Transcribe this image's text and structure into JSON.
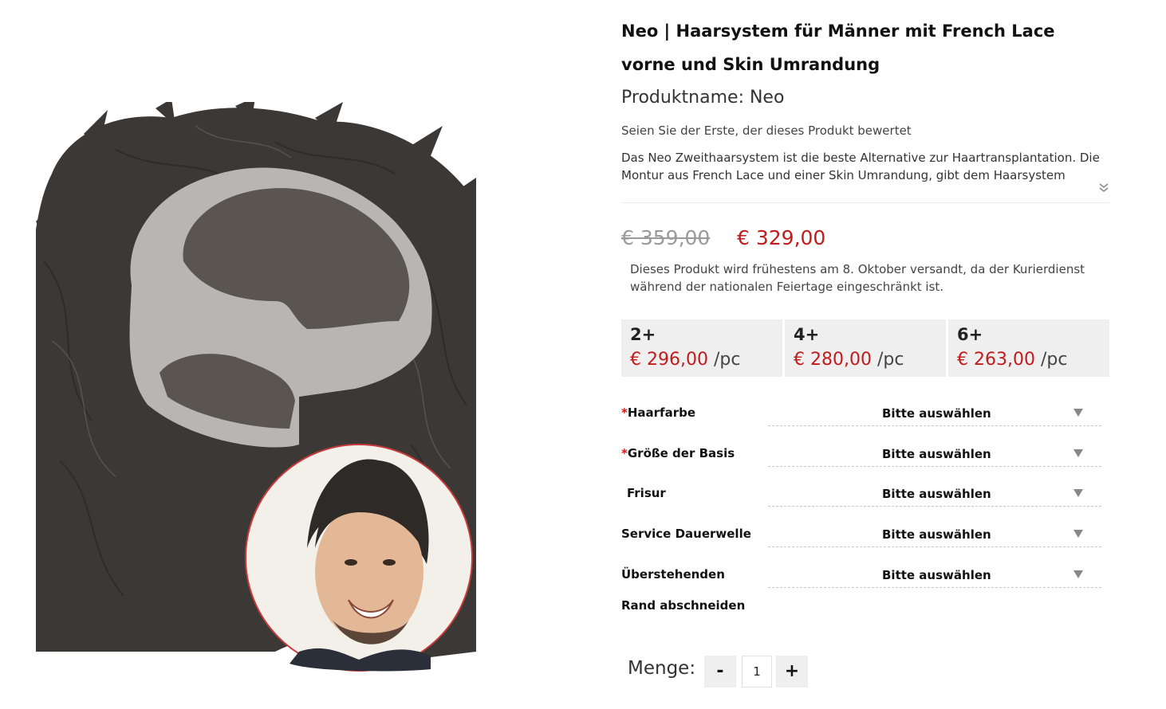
{
  "product": {
    "title": "Neo | Haarsystem für Männer mit French Lace vorne und Skin Umrandung",
    "name_line": "Produktname: Neo",
    "review_prompt": "Seien Sie der Erste, der dieses Produkt bewertet",
    "description": "Das Neo Zweithaarsystem ist die beste Alternative zur Haartransplantation. Die Montur aus French Lace und einer Skin Umrandung, gibt dem Haarsystem"
  },
  "pricing": {
    "old_price": "€ 359,00",
    "new_price": "€ 329,00",
    "shipping_note": "Dieses Produkt wird frühestens am 8. Oktober versandt, da der Kurierdienst während der nationalen Feiertage eingeschränkt ist.",
    "tiers": [
      {
        "qty": "2+",
        "price": "€ 296,00",
        "unit": "/pc"
      },
      {
        "qty": "4+",
        "price": "€ 280,00",
        "unit": "/pc"
      },
      {
        "qty": "6+",
        "price": "€ 263,00",
        "unit": "/pc"
      }
    ]
  },
  "options": [
    {
      "label": "Haarfarbe",
      "required": "*",
      "value": "Bitte auswählen"
    },
    {
      "label": "Größe der Basis",
      "required": "*",
      "value": "Bitte auswählen"
    },
    {
      "label": "Frisur",
      "required": "",
      "value": "Bitte auswählen"
    },
    {
      "label": "Service Dauerwelle",
      "required": "",
      "value": "Bitte auswählen"
    },
    {
      "label": "Überstehenden Rand abschneiden",
      "required": "",
      "value": "Bitte auswählen"
    }
  ],
  "quantity": {
    "label": "Menge:",
    "minus": "-",
    "plus": "+",
    "value": "1"
  },
  "colors": {
    "price_red": "#c21b1b",
    "required_red": "#dd1111",
    "tier_bg": "#efefef",
    "hair": "#3b3835",
    "lace": "#5a5550",
    "skin_border": "#b8b6b2",
    "inset_ring": "#c73a3a"
  }
}
